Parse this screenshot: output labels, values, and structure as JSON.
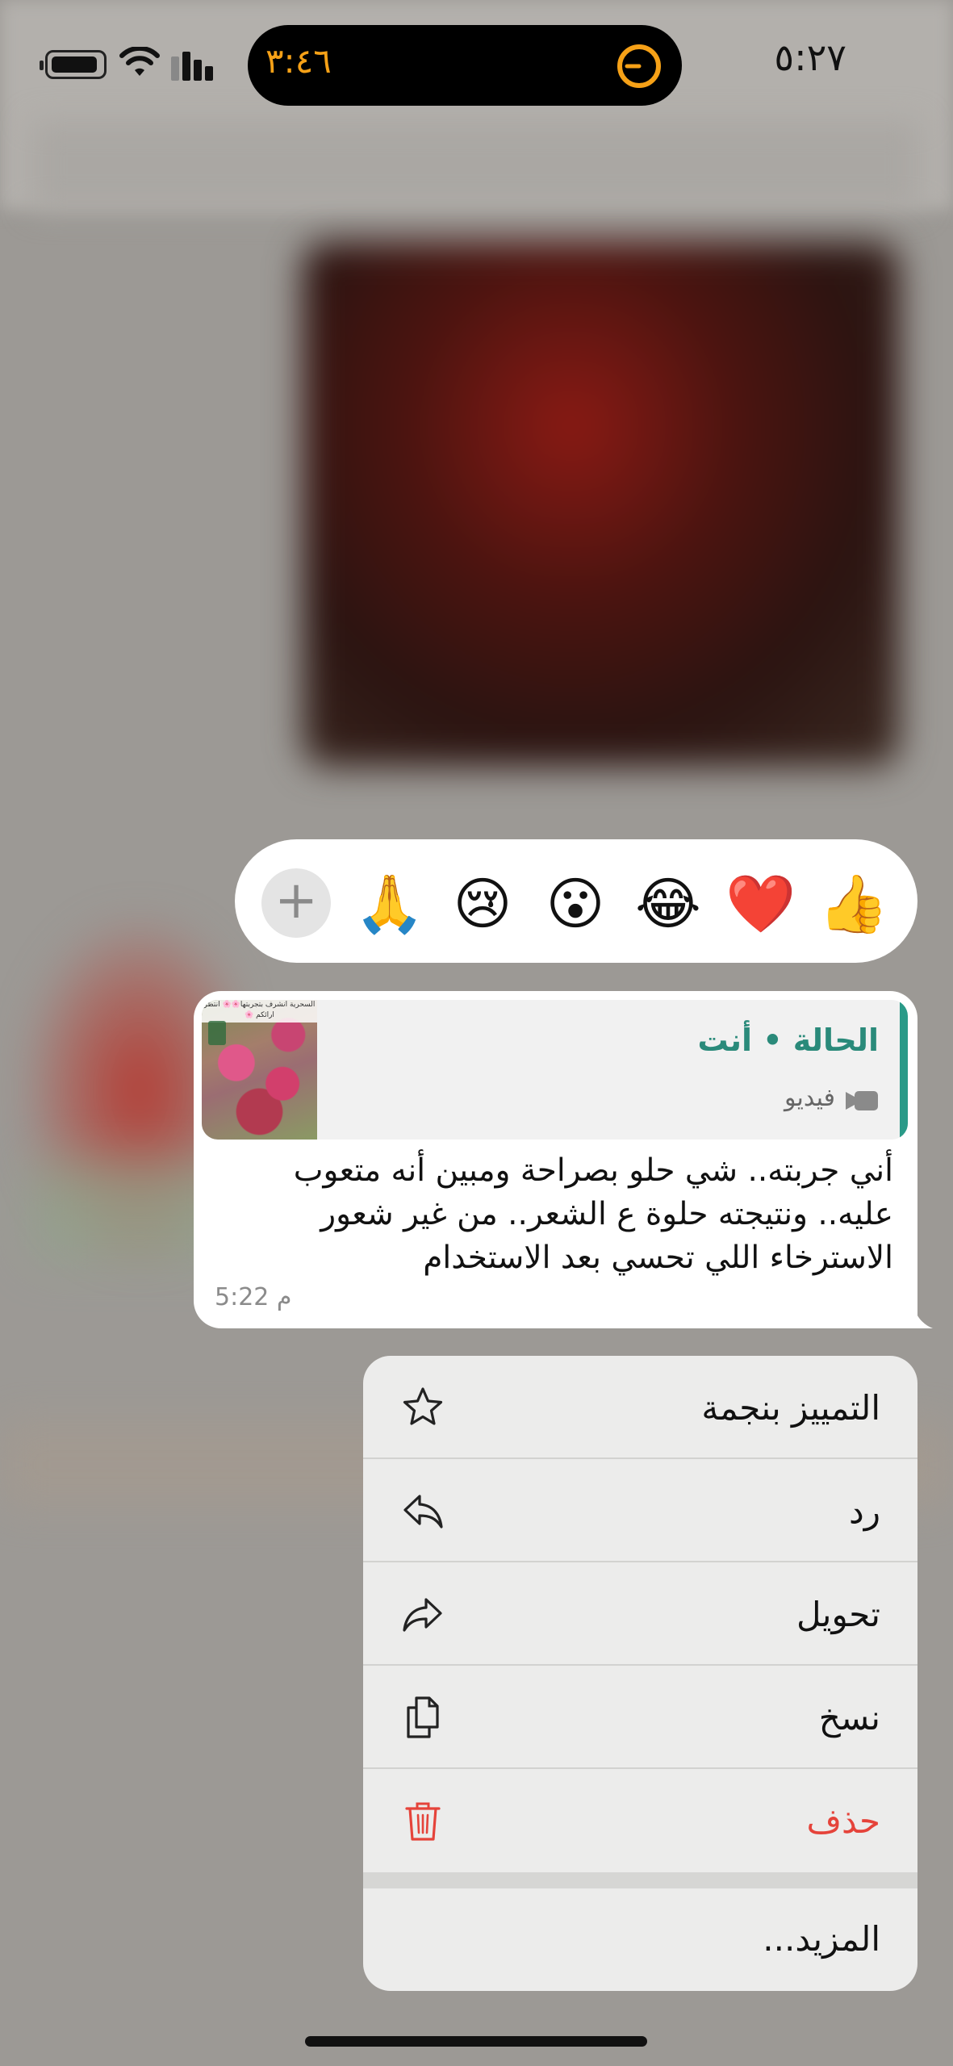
{
  "status_bar": {
    "time": "٥:٢٧",
    "live_activity_time": "٣:٤٦",
    "icons": [
      "battery-icon",
      "wifi-icon",
      "cellular-signal-icon",
      "timer-icon"
    ]
  },
  "reactions": {
    "items": [
      "👍",
      "❤️",
      "😂",
      "😮",
      "😢",
      "🙏"
    ],
    "more_icon": "plus-icon",
    "more_label": "+"
  },
  "message": {
    "quote": {
      "title": "الحالة • أنت",
      "type_label": "فيديو",
      "type_icon": "video-camera-icon",
      "thumbnail_caption": "السحرية انشرف بتجربتها🌸🌸 انتظر ارائكم 🌸"
    },
    "text_lines": [
      "أني جربته.. شي حلو بصراحة ومبين أنه متعوب",
      "عليه.. ونتيجته حلوة ع الشعر.. من غير شعور",
      "الاسترخاء اللي تحسي بعد الاستخدام"
    ],
    "time": "5:22 م"
  },
  "context_menu": {
    "items": [
      {
        "label": "التمييز بنجمة",
        "icon": "star-icon"
      },
      {
        "label": "رد",
        "icon": "reply-icon"
      },
      {
        "label": "تحويل",
        "icon": "forward-icon"
      },
      {
        "label": "نسخ",
        "icon": "copy-icon"
      },
      {
        "label": "حذف",
        "icon": "trash-icon",
        "color": "#e5433a"
      }
    ],
    "more_label": "المزيد..."
  },
  "colors": {
    "accent": "#2a8a7a",
    "danger": "#e5433a",
    "live_activity": "#f6a117"
  }
}
